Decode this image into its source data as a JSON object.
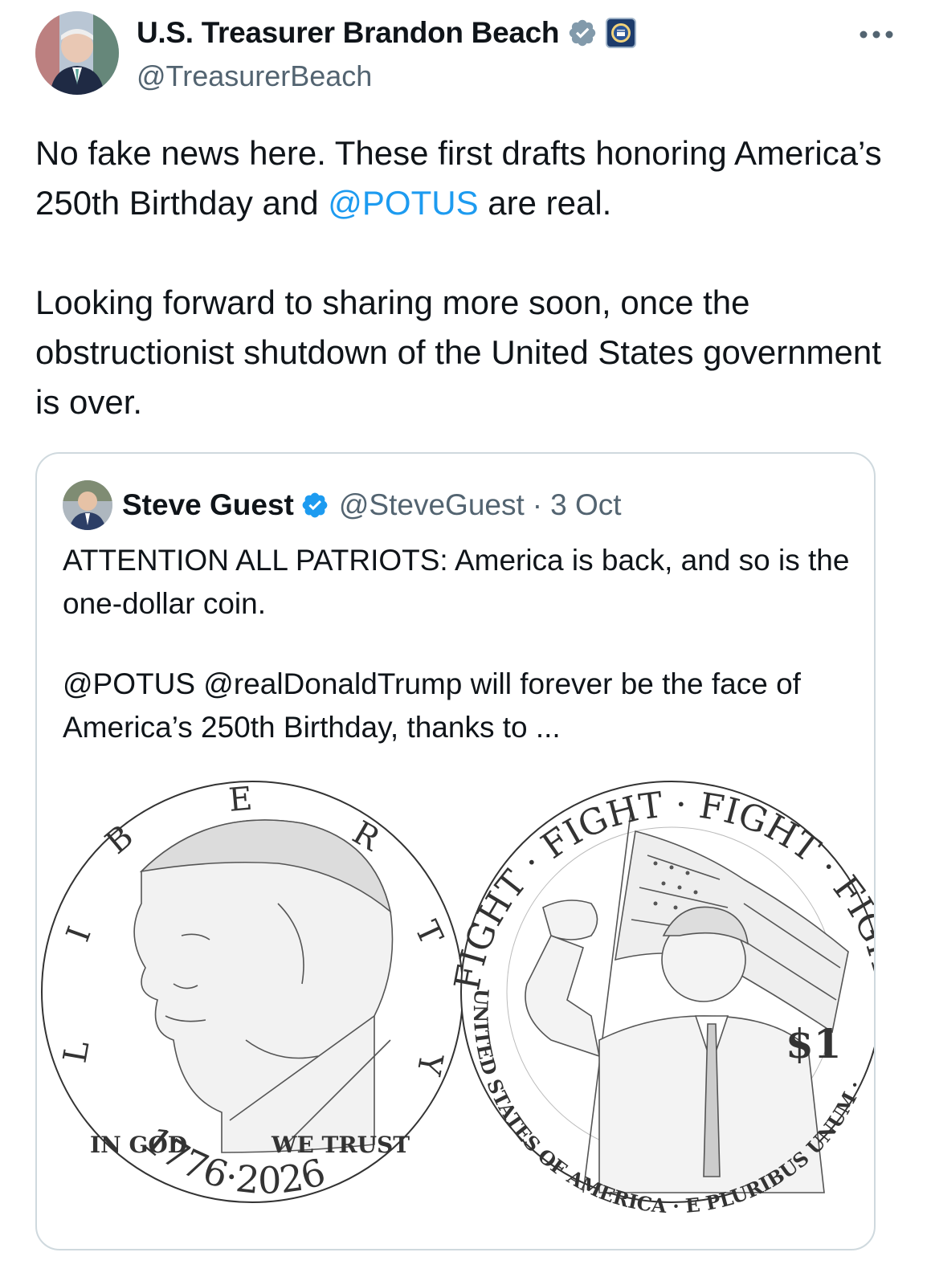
{
  "author": {
    "display_name": "U.S. Treasurer Brandon Beach",
    "handle": "@TreasurerBeach"
  },
  "tweet": {
    "line1_pre": "No fake news here. These first drafts honoring America’s 250th Birthday and ",
    "mention": "@POTUS",
    "line1_post": " are real.",
    "paragraph2": "Looking forward to sharing more soon, once the obstructionist shutdown of the United States government is over."
  },
  "quote": {
    "display_name": "Steve Guest",
    "handle": "@SteveGuest",
    "separator": "·",
    "time": "3 Oct",
    "paragraph1": "ATTENTION ALL PATRIOTS: America is back, and so is the one-dollar coin.",
    "paragraph2": "@POTUS @realDonaldTrump will forever be the face of America’s 250th Birthday, thanks to ..."
  },
  "coins": {
    "left": {
      "legend_letters": [
        "L",
        "I",
        "B",
        "E",
        "R",
        "T",
        "Y"
      ],
      "motto_left": "IN GOD",
      "motto_right": "WE TRUST",
      "dates": "1776·2026"
    },
    "right": {
      "top_legend": "FIGHT · FIGHT · FIGHT · FIGHT",
      "bottom_legend": "UNITED STATES OF AMERICA · E PLURIBUS UNUM ·",
      "denomination": "$1"
    }
  },
  "colors": {
    "text": "#0f1419",
    "secondary": "#536471",
    "link": "#1d9bf0",
    "verified_gray": "#829aab",
    "verified_blue": "#1d9bf0",
    "border": "#cfd9de"
  },
  "icons": {
    "more": "more-horizontal-icon",
    "verified_main": "verified-gray-badge-icon",
    "affiliate": "treasury-seal-icon",
    "verified_quote": "verified-blue-badge-icon"
  }
}
